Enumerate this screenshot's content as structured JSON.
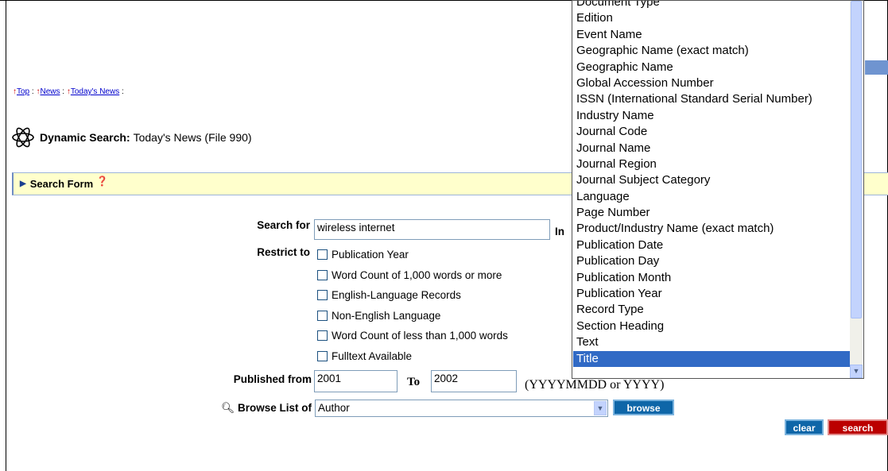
{
  "breadcrumb": {
    "items": [
      {
        "label": "Top"
      },
      {
        "label": "News"
      },
      {
        "label": "Today's News"
      }
    ],
    "separator": ":"
  },
  "header": {
    "title_label": "Dynamic Search:",
    "title_value": "Today's News (File 990)"
  },
  "search_form": {
    "bar_label": "Search Form",
    "search_for_label": "Search for",
    "search_for_value": "wireless internet",
    "in_label": "In",
    "restrict_label": "Restrict to",
    "restrict_options": [
      "Publication Year",
      "Word Count of 1,000 words or more",
      "English-Language Records",
      "Non-English Language",
      "Word Count of less than 1,000 words",
      "Fulltext Available"
    ],
    "published_from_label": "Published from",
    "published_from_value": "2001",
    "to_label": "To",
    "to_value": "2002",
    "date_hint": "(YYYYMMDD or YYYY)",
    "browse_label": "Browse List of",
    "browse_selected": "Author",
    "browse_button": "browse",
    "clear_button": "clear",
    "search_button": "search"
  },
  "field_list": {
    "options": [
      "Document Type",
      "Edition",
      "Event Name",
      "Geographic Name (exact match)",
      "Geographic Name",
      "Global Accession Number",
      "ISSN (International Standard Serial Number)",
      "Industry Name",
      "Journal Code",
      "Journal Name",
      "Journal Region",
      "Journal Subject Category",
      "Language",
      "Page Number",
      "Product/Industry Name (exact match)",
      "Publication Date",
      "Publication Day",
      "Publication Month",
      "Publication Year",
      "Record Type",
      "Section Heading",
      "Text",
      "Title"
    ],
    "selected": "Title"
  },
  "colors": {
    "accent": "#0e66a8",
    "search_button": "#bb0000",
    "form_bar": "#ffffcc",
    "list_selection": "#316ac5"
  },
  "icons": {
    "breadcrumb_arrow": "up-arrow-icon",
    "logo": "atom-icon",
    "form_toggle": "triangle-right-icon",
    "help": "help-icon",
    "browse": "magnifier-icon"
  }
}
